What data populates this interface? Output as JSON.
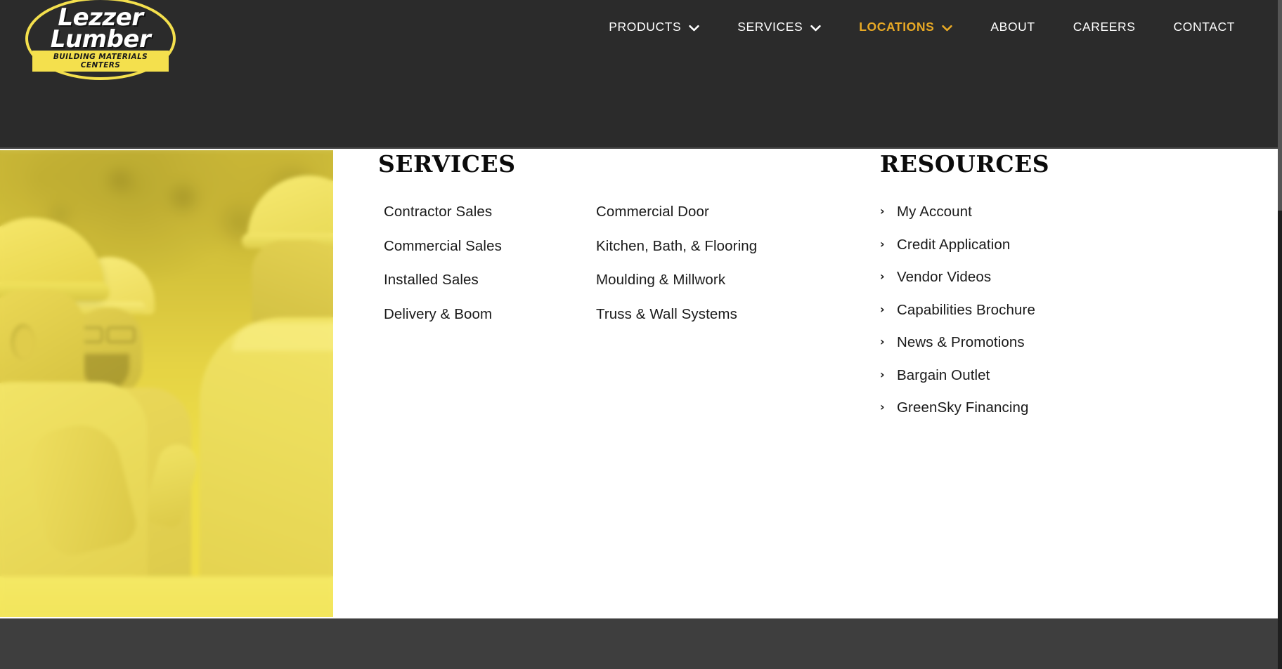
{
  "header": {
    "background_color": "#2b2b2b",
    "logo": {
      "name": "Lezzer Lumber",
      "line1": "Lezzer",
      "line2": "Lumber",
      "tagline": "BUILDING MATERIALS CENTERS",
      "accent_color": "#f4e04d"
    },
    "nav": {
      "active_color": "#e8a925",
      "items": [
        {
          "label": "PRODUCTS",
          "has_dropdown": true,
          "active": false,
          "icon": "chevron-down-icon"
        },
        {
          "label": "SERVICES",
          "has_dropdown": true,
          "active": false,
          "icon": "chevron-down-icon"
        },
        {
          "label": "LOCATIONS",
          "has_dropdown": true,
          "active": true,
          "icon": "chevron-down-icon"
        },
        {
          "label": "ABOUT",
          "has_dropdown": false,
          "active": false,
          "icon": ""
        },
        {
          "label": "CAREERS",
          "has_dropdown": false,
          "active": false,
          "icon": ""
        },
        {
          "label": "CONTACT",
          "has_dropdown": false,
          "active": false,
          "icon": ""
        }
      ]
    }
  },
  "photo": {
    "alt": "Construction workers in hard hats talking on a job site",
    "tint_color": "#f2e14e"
  },
  "footer": {
    "services": {
      "heading": "SERVICES",
      "column1": [
        {
          "label": "Contractor Sales"
        },
        {
          "label": "Commercial Sales"
        },
        {
          "label": "Installed Sales"
        },
        {
          "label": "Delivery & Boom"
        }
      ],
      "column2": [
        {
          "label": "Commercial Door"
        },
        {
          "label": "Kitchen, Bath, & Flooring"
        },
        {
          "label": "Moulding & Millwork"
        },
        {
          "label": "Truss & Wall Systems"
        }
      ]
    },
    "resources": {
      "heading": "RESOURCES",
      "bullet": "›",
      "items": [
        {
          "label": "My Account"
        },
        {
          "label": "Credit Application"
        },
        {
          "label": "Vendor Videos"
        },
        {
          "label": "Capabilities Brochure"
        },
        {
          "label": "News & Promotions"
        },
        {
          "label": "Bargain Outlet"
        },
        {
          "label": "GreenSky Financing"
        }
      ]
    }
  },
  "bottom_bar": {
    "background_color": "#3e3e3e"
  }
}
